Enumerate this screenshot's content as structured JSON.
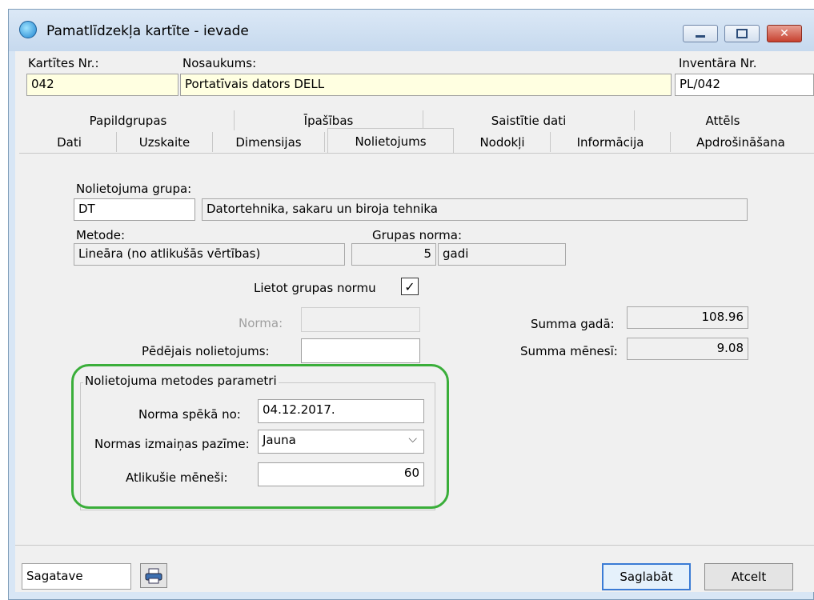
{
  "window": {
    "title": "Pamatlīdzekļa kartīte - ievade"
  },
  "header": {
    "card_no_label": "Kartītes Nr.:",
    "card_no_value": "042",
    "name_label": "Nosaukums:",
    "name_value": "Portatīvais dators DELL",
    "inventory_label": "Inventāra Nr.",
    "inventory_value": "PL/042"
  },
  "tabs_row1": [
    "Papildgrupas",
    "Īpašības",
    "Saistītie dati",
    "Attēls"
  ],
  "tabs_row2": [
    "Dati",
    "Uzskaite",
    "Dimensijas",
    "Nolietojums",
    "Nodokļi",
    "Informācija",
    "Apdrošināšana"
  ],
  "active_tab": "Nolietojums",
  "depreciation": {
    "group_label": "Nolietojuma grupa:",
    "group_code": "DT",
    "group_name": "Datortehnika, sakaru un biroja tehnika",
    "method_label": "Metode:",
    "method_value": "Lineāra (no atlikušās vērtības)",
    "group_norm_label": "Grupas norma:",
    "group_norm_value": "5",
    "group_norm_unit": "gadi",
    "use_group_norm_label": "Lietot grupas normu",
    "use_group_norm_checked": true,
    "norm_label": "Norma:",
    "norm_value": "",
    "last_depr_label": "Pēdējais nolietojums:",
    "last_depr_value": "",
    "sum_year_label": "Summa gadā:",
    "sum_year_value": "108.96",
    "sum_month_label": "Summa mēnesī:",
    "sum_month_value": "9.08"
  },
  "params": {
    "legend": "Nolietojuma metodes parametri",
    "norm_from_label": "Norma spēkā no:",
    "norm_from_value": "04.12.2017.",
    "change_label": "Normas izmaiņas pazīme:",
    "change_value": "Jauna",
    "remaining_label": "Atlikušie mēneši:",
    "remaining_value": "60"
  },
  "footer": {
    "status": "Sagatave",
    "save_label": "Saglabāt",
    "cancel_label": "Atcelt"
  },
  "colors": {
    "highlight": "#3aae3a",
    "yellow_field": "#ffffe1"
  }
}
